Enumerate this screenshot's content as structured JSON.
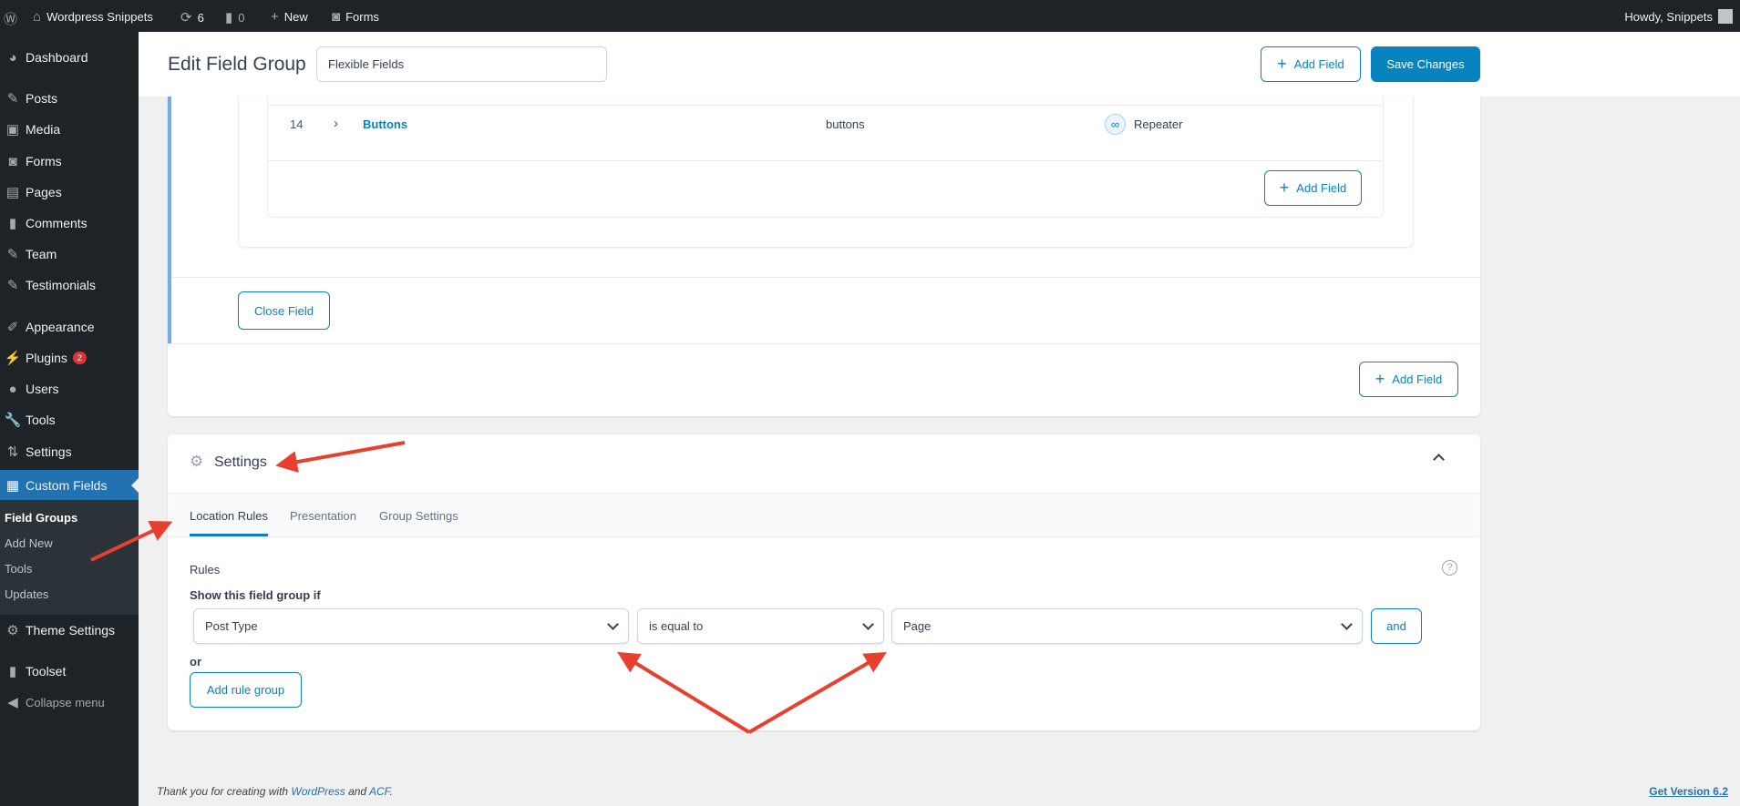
{
  "adminbar": {
    "site": "Wordpress Snippets",
    "updates": "6",
    "comments": "0",
    "new": "New",
    "forms": "Forms",
    "howdy": "Howdy, Snippets"
  },
  "sidebar": {
    "items": [
      {
        "label": "Dashboard",
        "icon": "dashboard-icon"
      },
      {
        "label": "Posts",
        "icon": "pin-icon"
      },
      {
        "label": "Media",
        "icon": "media-icon"
      },
      {
        "label": "Forms",
        "icon": "forms-icon"
      },
      {
        "label": "Pages",
        "icon": "pages-icon"
      },
      {
        "label": "Comments",
        "icon": "comment-icon"
      },
      {
        "label": "Team",
        "icon": "pin-icon"
      },
      {
        "label": "Testimonials",
        "icon": "pin-icon"
      },
      {
        "label": "Appearance",
        "icon": "brush-icon"
      },
      {
        "label": "Plugins",
        "icon": "plugin-icon",
        "badge": "2"
      },
      {
        "label": "Users",
        "icon": "users-icon"
      },
      {
        "label": "Tools",
        "icon": "wrench-icon"
      },
      {
        "label": "Settings",
        "icon": "settings-icon"
      },
      {
        "label": "Custom Fields",
        "icon": "table-icon"
      }
    ],
    "submenu": [
      "Field Groups",
      "Add New",
      "Tools",
      "Updates"
    ],
    "after": [
      {
        "label": "Theme Settings",
        "icon": "gear-icon"
      },
      {
        "label": "Toolset",
        "icon": "toolset-icon"
      },
      {
        "label": "Collapse menu",
        "icon": "collapse-icon"
      }
    ]
  },
  "header": {
    "title": "Edit Field Group",
    "group_name": "Flexible Fields",
    "add_field": "Add Field",
    "save": "Save Changes"
  },
  "field_row": {
    "order": "14",
    "label": "Buttons",
    "name": "buttons",
    "type": "Repeater"
  },
  "inner_add_field": "Add Field",
  "close_field": "Close Field",
  "outer_add_field": "Add Field",
  "settings": {
    "title": "Settings",
    "tabs": [
      "Location Rules",
      "Presentation",
      "Group Settings"
    ],
    "rules_label": "Rules",
    "show_if": "Show this field group if",
    "param": "Post Type",
    "operator": "is equal to",
    "value": "Page",
    "and": "and",
    "or": "or",
    "add_rule_group": "Add rule group",
    "help": "?"
  },
  "footer": {
    "thanks_pre": "Thank you for creating with ",
    "wp": "WordPress",
    "and": " and ",
    "acf": "ACF",
    "dot": ".",
    "version": "Get Version 6.2"
  },
  "colors": {
    "accent": "#0783be",
    "arrow": "#e8402f"
  }
}
